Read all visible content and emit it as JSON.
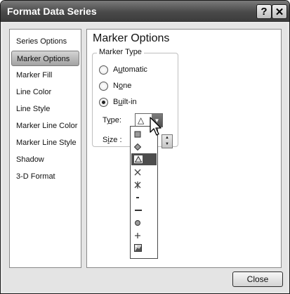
{
  "window": {
    "title": "Format Data Series",
    "help_glyph": "?",
    "close_glyph": "✕"
  },
  "sidebar": {
    "items": [
      {
        "label": "Series Options"
      },
      {
        "label": "Marker Options",
        "selected": true
      },
      {
        "label": "Marker Fill"
      },
      {
        "label": "Line Color"
      },
      {
        "label": "Line Style"
      },
      {
        "label": "Marker Line Color"
      },
      {
        "label": "Marker Line Style"
      },
      {
        "label": "Shadow"
      },
      {
        "label": "3-D Format"
      }
    ]
  },
  "panel": {
    "title": "Marker Options",
    "group_label": "Marker Type",
    "radios": [
      {
        "label": "Automatic",
        "checked": false
      },
      {
        "label": "None",
        "checked": false
      },
      {
        "label": "Built-in",
        "checked": true
      }
    ],
    "type_label": "Type:",
    "type_value": "△",
    "size_label": "Size :"
  },
  "dropdown": {
    "items": [
      {
        "marker": "square"
      },
      {
        "marker": "diamond"
      },
      {
        "marker": "triangle",
        "selected": true
      },
      {
        "marker": "x"
      },
      {
        "marker": "star"
      },
      {
        "marker": "short-dash"
      },
      {
        "marker": "long-dash"
      },
      {
        "marker": "circle"
      },
      {
        "marker": "plus"
      },
      {
        "marker": "picture"
      }
    ]
  },
  "footer": {
    "close_label": "Close"
  }
}
